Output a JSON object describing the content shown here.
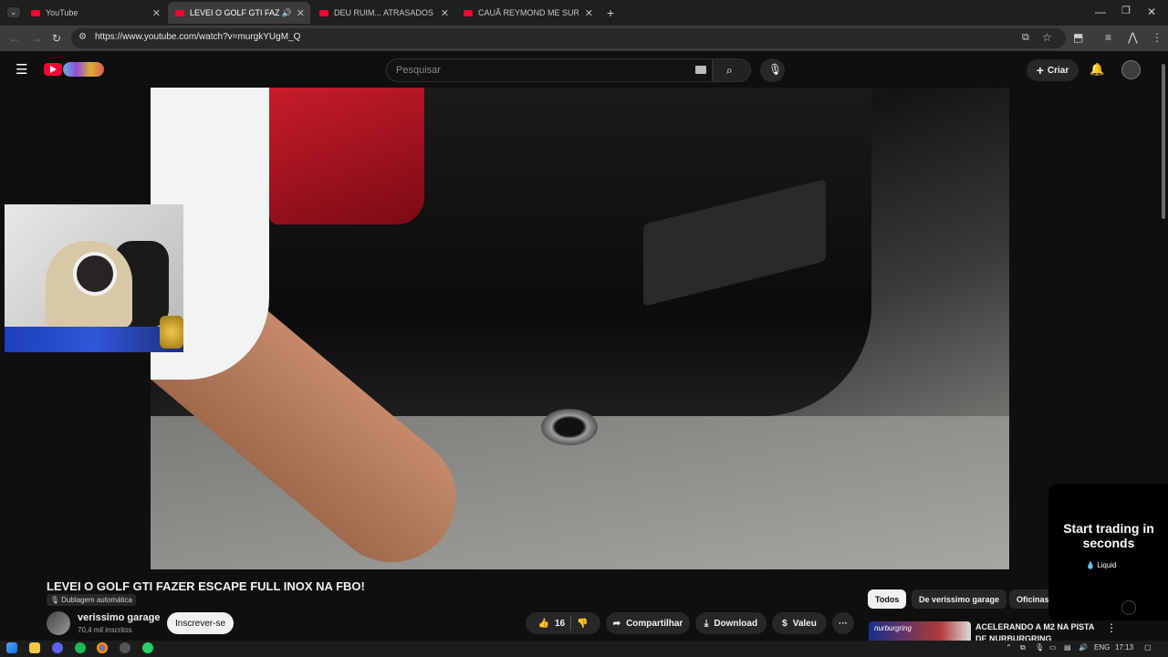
{
  "browser": {
    "tabs": [
      {
        "label": "YouTube",
        "active": false
      },
      {
        "label": "LEVEI O GOLF GTI FAZER ES",
        "active": true
      },
      {
        "label": "DEU RUIM... ATRASADOS DE P",
        "active": false
      },
      {
        "label": "CAUÃ REYMOND ME SURPREE",
        "active": false
      }
    ],
    "url": "https://www.youtube.com/watch?v=murgkYUgM_Q"
  },
  "header": {
    "search_placeholder": "Pesquisar",
    "create_label": "Criar"
  },
  "video": {
    "title": "LEVEI O GOLF GTI FAZER ESCAPE FULL INOX NA FBO!",
    "dubbing_badge": "Dublagem automática",
    "channel_name": "verissimo garage",
    "subscribers": "70,4 mil inscritos",
    "subscribe_label": "Inscrever-se",
    "like_count": "16",
    "share_label": "Compartilhar",
    "download_label": "Download",
    "thanks_label": "Valeu",
    "more_label": "···"
  },
  "sidebar": {
    "chips": [
      {
        "label": "Todos",
        "selected": true
      },
      {
        "label": "De verissimo garage",
        "selected": false
      },
      {
        "label": "Oficinas mecân",
        "selected": false
      }
    ],
    "recommendation": {
      "title": "ACELERANDO A M2 NA PISTA DE NURBURGRING",
      "thumb_text": "nurburgring"
    }
  },
  "ad": {
    "headline": "Start trading in seconds",
    "brand": "Liquid"
  },
  "taskbar": {
    "language": "ENG",
    "time": "17:13"
  },
  "colors": {
    "youtube_red": "#ff0033",
    "background": "#0f0f0f",
    "chip_selected": "#f1f1f1"
  }
}
